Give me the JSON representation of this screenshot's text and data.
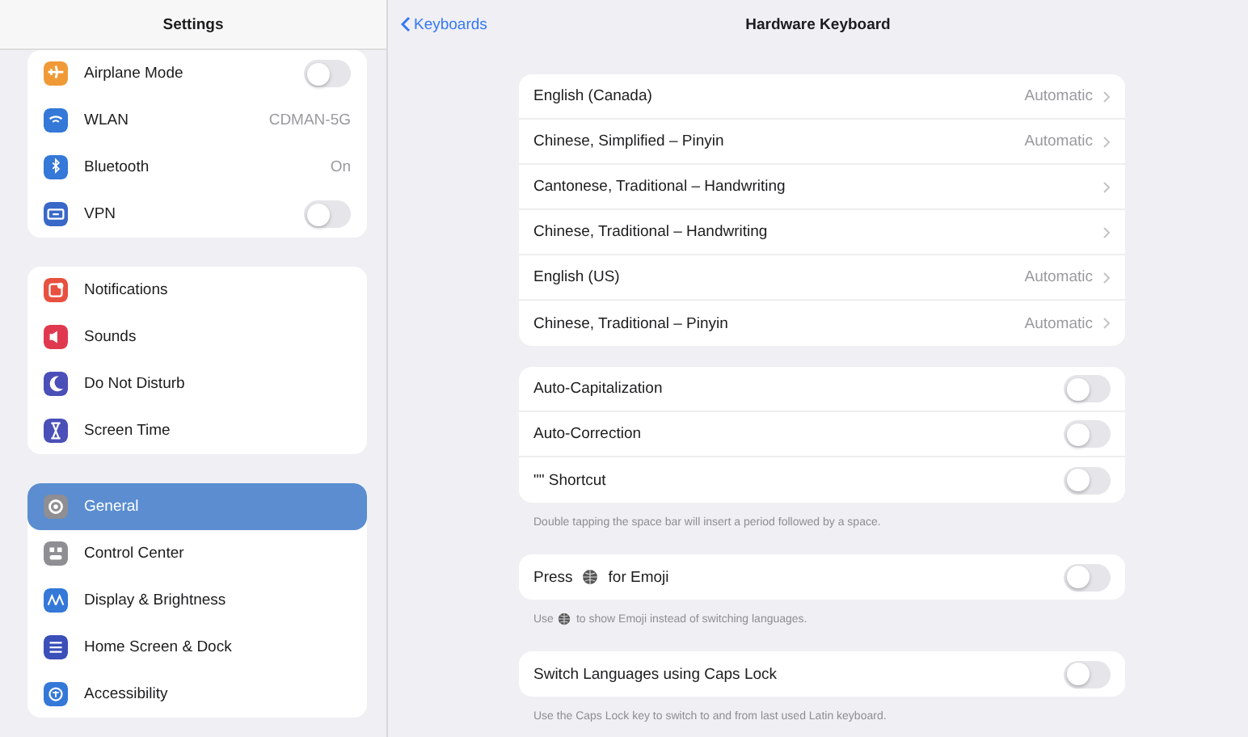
{
  "sidebar": {
    "title": "Settings",
    "groups": [
      {
        "items": [
          {
            "label": "Airplane Mode",
            "kind": "toggle",
            "on": false,
            "color": "#f09a37",
            "selected": false
          },
          {
            "label": "WLAN",
            "kind": "value",
            "value": "CDMAN-5G",
            "color": "#3478d8",
            "selected": false
          },
          {
            "label": "Bluetooth",
            "kind": "value",
            "value": "On",
            "color": "#3478d8",
            "selected": false
          },
          {
            "label": "VPN",
            "kind": "toggle",
            "on": false,
            "color": "#3a68c8",
            "selected": false
          }
        ]
      },
      {
        "items": [
          {
            "label": "Notifications",
            "kind": "plain",
            "color": "#e8503f",
            "selected": false
          },
          {
            "label": "Sounds",
            "kind": "plain",
            "color": "#e0394f",
            "selected": false
          },
          {
            "label": "Do Not Disturb",
            "kind": "plain",
            "color": "#4b4fb8",
            "selected": false
          },
          {
            "label": "Screen Time",
            "kind": "plain",
            "color": "#4b4fb8",
            "selected": false
          }
        ]
      },
      {
        "items": [
          {
            "label": "General",
            "kind": "plain",
            "color": "#8e8e93",
            "selected": true
          },
          {
            "label": "Control Center",
            "kind": "plain",
            "color": "#8e8e93",
            "selected": false
          },
          {
            "label": "Display & Brightness",
            "kind": "plain",
            "color": "#3478d8",
            "selected": false
          },
          {
            "label": "Home Screen & Dock",
            "kind": "plain",
            "color": "#3a4fb8",
            "selected": false
          },
          {
            "label": "Accessibility",
            "kind": "plain",
            "color": "#3478d8",
            "selected": false
          }
        ]
      }
    ]
  },
  "nav": {
    "back": "Keyboards",
    "title": "Hardware Keyboard"
  },
  "keyboards": [
    {
      "label": "English (Canada)",
      "value": "Automatic"
    },
    {
      "label": "Chinese, Simplified – Pinyin",
      "value": "Automatic"
    },
    {
      "label": "Cantonese, Traditional – Handwriting"
    },
    {
      "label": "Chinese, Traditional – Handwriting"
    },
    {
      "label": "English (US)",
      "value": "Automatic"
    },
    {
      "label": "Chinese, Traditional – Pinyin",
      "value": "Automatic"
    }
  ],
  "option_groups": [
    {
      "rows": [
        {
          "label": "Auto-Capitalization",
          "on": false
        },
        {
          "label": "Auto-Correction",
          "on": false
        },
        {
          "label": "\"\" Shortcut",
          "on": false
        }
      ],
      "footer": {
        "text": "Double tapping the space bar will insert a period followed by a space."
      }
    },
    {
      "rows": [
        {
          "label": "Press",
          "label_after": "for Emoji",
          "on": false
        }
      ],
      "footer": {
        "text": "Use",
        "text_after": "to show Emoji instead of switching languages."
      }
    },
    {
      "rows": [
        {
          "label": "Switch Languages using Caps Lock",
          "on": false
        }
      ],
      "footer": {
        "text": "Use the Caps Lock key to switch to and from last used Latin keyboard."
      }
    }
  ]
}
